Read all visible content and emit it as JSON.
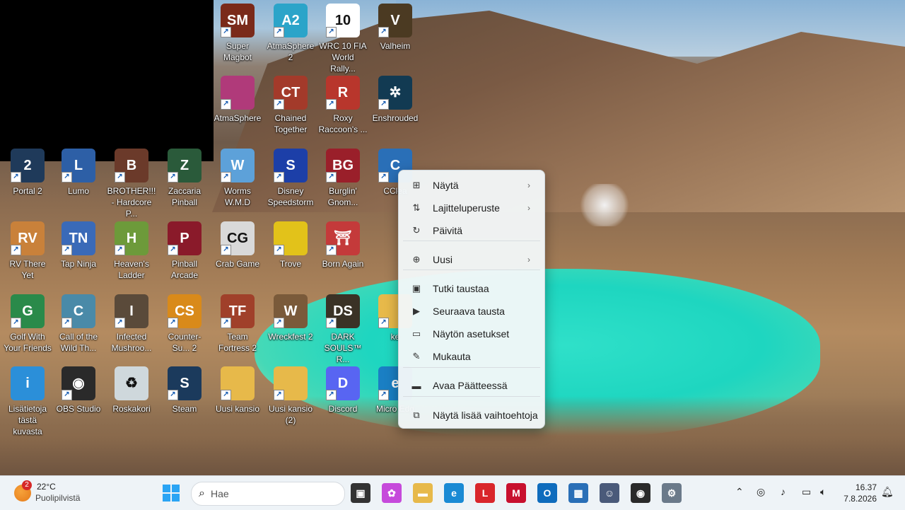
{
  "desktop": {
    "icons": [
      {
        "label": "Super Magbot",
        "color": "#7a2a1a",
        "glyph": "SM"
      },
      {
        "label": "AtmaSphere 2",
        "color": "#2ba4c9",
        "glyph": "A2"
      },
      {
        "label": "WRC 10 FIA World Rally...",
        "color": "#ffffff",
        "glyph": "10"
      },
      {
        "label": "Valheim",
        "color": "#4b3a22",
        "glyph": "V"
      },
      {
        "label": "AtmaSphere",
        "color": "#b03a7a",
        "glyph": ""
      },
      {
        "label": "Chained Together",
        "color": "#a33a2a",
        "glyph": "CT"
      },
      {
        "label": "Roxy Raccoon's ...",
        "color": "#b8362c",
        "glyph": "R"
      },
      {
        "label": "Enshrouded",
        "color": "#123a52",
        "glyph": "✲"
      },
      {
        "label": "Portal 2",
        "color": "#1f3a5a",
        "glyph": "2"
      },
      {
        "label": "Lumo",
        "color": "#2d5fa6",
        "glyph": "L"
      },
      {
        "label": "BROTHER!!! - Hardcore P...",
        "color": "#6b3a2a",
        "glyph": "B"
      },
      {
        "label": "Zaccaria Pinball",
        "color": "#2a5a3a",
        "glyph": "Z"
      },
      {
        "label": "Worms W.M.D",
        "color": "#5da1d9",
        "glyph": "W"
      },
      {
        "label": "Disney Speedstorm",
        "color": "#1c3fa8",
        "glyph": "S"
      },
      {
        "label": "Burglin' Gnom...",
        "color": "#9a1f2a",
        "glyph": "BG"
      },
      {
        "label": "CClea",
        "color": "#2a6fb7",
        "glyph": "C"
      },
      {
        "label": "RV There Yet",
        "color": "#c9813a",
        "glyph": "RV"
      },
      {
        "label": "Tap Ninja",
        "color": "#3a6ab8",
        "glyph": "TN"
      },
      {
        "label": "Heaven's Ladder",
        "color": "#6d9a3a",
        "glyph": "H"
      },
      {
        "label": "Pinball Arcade",
        "color": "#8a1a2a",
        "glyph": "P"
      },
      {
        "label": "Crab Game",
        "color": "#d9d9d9",
        "glyph": "CG"
      },
      {
        "label": "Trove",
        "color": "#e2c21a",
        "glyph": ""
      },
      {
        "label": "Born Again",
        "color": "#c43a3a",
        "glyph": "⛩"
      },
      {
        "label": "Golf With Your Friends",
        "color": "#2a8a4a",
        "glyph": "G"
      },
      {
        "label": "Call of the Wild Th...",
        "color": "#4a8aa8",
        "glyph": "C"
      },
      {
        "label": "Infected Mushroo...",
        "color": "#5a4a3a",
        "glyph": "I"
      },
      {
        "label": "Counter-Su... 2",
        "color": "#d98a1a",
        "glyph": "CS"
      },
      {
        "label": "Team Fortress 2",
        "color": "#a0402a",
        "glyph": "TF"
      },
      {
        "label": "Wreckfest 2",
        "color": "#7a5a3a",
        "glyph": "W"
      },
      {
        "label": "DARK SOULS™ R...",
        "color": "#3a3226",
        "glyph": "DS"
      },
      {
        "label": "ke",
        "color": "#e7b94a",
        "glyph": ""
      },
      {
        "label": "Lisätietoja tästä kuvasta",
        "color": "#2b8fd9",
        "glyph": "i"
      },
      {
        "label": "OBS Studio",
        "color": "#2a2a2a",
        "glyph": "◉"
      },
      {
        "label": "Roskakori",
        "color": "#cfd8dc",
        "glyph": "♻"
      },
      {
        "label": "Steam",
        "color": "#1b3a5c",
        "glyph": "S"
      },
      {
        "label": "Uusi kansio",
        "color": "#e7b94a",
        "glyph": ""
      },
      {
        "label": "Uusi kansio (2)",
        "color": "#e7b94a",
        "glyph": ""
      },
      {
        "label": "Discord",
        "color": "#5865f2",
        "glyph": "D"
      },
      {
        "label": "Micro Edg",
        "color": "#1a7fc4",
        "glyph": "e"
      }
    ]
  },
  "context_menu": {
    "items": [
      {
        "label": "Näytä",
        "icon": "grid-icon",
        "glyph": "⊞",
        "submenu": true
      },
      {
        "label": "Lajitteluperuste",
        "icon": "sort-icon",
        "glyph": "⇅",
        "submenu": true
      },
      {
        "label": "Päivitä",
        "icon": "refresh-icon",
        "glyph": "↻",
        "submenu": false
      },
      {
        "label": "Uusi",
        "icon": "new-icon",
        "glyph": "⊕",
        "submenu": true
      },
      {
        "label": "Tutki taustaa",
        "icon": "image-search-icon",
        "glyph": "▣",
        "submenu": false
      },
      {
        "label": "Seuraava tausta",
        "icon": "next-background-icon",
        "glyph": "▶",
        "submenu": false
      },
      {
        "label": "Näytön asetukset",
        "icon": "display-settings-icon",
        "glyph": "▭",
        "submenu": false
      },
      {
        "label": "Mukauta",
        "icon": "pen-icon",
        "glyph": "✎",
        "submenu": false
      },
      {
        "label": "Avaa Päätteessä",
        "icon": "terminal-icon",
        "glyph": "▬",
        "submenu": false
      },
      {
        "label": "Näytä lisää vaihtoehtoja",
        "icon": "more-options-icon",
        "glyph": "⧉",
        "submenu": false
      }
    ]
  },
  "taskbar": {
    "weather": {
      "badge": "2",
      "temp": "22°C",
      "desc": "Puolipilvistä"
    },
    "search_placeholder": "Hae",
    "apps": [
      {
        "name": "task-view",
        "color": "#333333",
        "glyph": "▣"
      },
      {
        "name": "copilot",
        "color": "#c64adb",
        "glyph": "✿"
      },
      {
        "name": "file-explorer",
        "color": "#e7b94a",
        "glyph": "▬"
      },
      {
        "name": "edge",
        "color": "#1a8ad4",
        "glyph": "e"
      },
      {
        "name": "app-l",
        "color": "#d9262b",
        "glyph": "L"
      },
      {
        "name": "mcafee",
        "color": "#c8102e",
        "glyph": "M"
      },
      {
        "name": "outlook",
        "color": "#0f6cbd",
        "glyph": "O"
      },
      {
        "name": "store",
        "color": "#2a6fb7",
        "glyph": "▦"
      },
      {
        "name": "photos",
        "color": "#4a5a7a",
        "glyph": "☺"
      },
      {
        "name": "obs",
        "color": "#2a2a2a",
        "glyph": "◉"
      },
      {
        "name": "settings",
        "color": "#6b7a8a",
        "glyph": "⚙"
      }
    ],
    "tray": {
      "time": "16.37",
      "date": "7.8.2026"
    }
  }
}
